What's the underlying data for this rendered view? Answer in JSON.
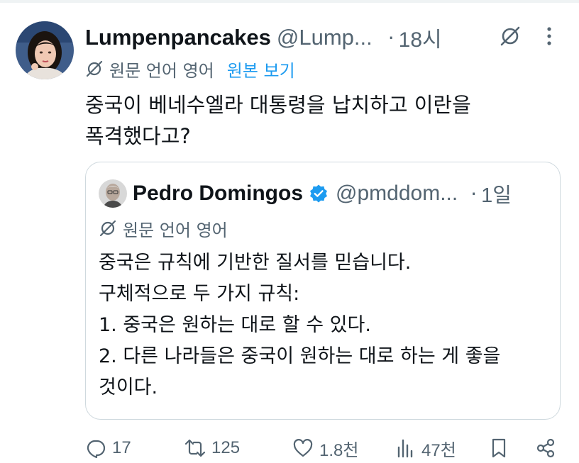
{
  "tweet": {
    "display_name": "Lumpenpancakes",
    "handle": "@Lump...",
    "dot": "·",
    "time": "18시",
    "translated_from": "원문 언어 영어",
    "show_original": "원본 보기",
    "text_lines": [
      "중국이 베네수엘라 대통령을 납치하고 이란을",
      "폭격했다고?"
    ]
  },
  "quote": {
    "display_name": "Pedro Domingos",
    "handle": "@pmddom...",
    "dot": "·",
    "time": "1일",
    "translated_from": "원문 언어 영어",
    "text_lines": [
      "중국은 규칙에 기반한 질서를 믿습니다.",
      "구체적으로 두 가지 규칙:",
      "1. 중국은 원하는 대로 할 수 있다.",
      "2. 다른 나라들은 중국이 원하는 대로 하는 게 좋을",
      "것이다."
    ]
  },
  "actions": {
    "reply_count": "17",
    "repost_count": "125",
    "like_count": "1.8천",
    "view_count": "47천"
  },
  "colors": {
    "text_primary": "#0f1419",
    "text_secondary": "#536471",
    "link": "#1d9bf0",
    "verified_badge": "#1d9bf0",
    "border": "#cfd9de"
  },
  "icons": {
    "translate": "translate-icon",
    "grok": "grok-icon",
    "more": "more-icon",
    "verified": "verified-badge-icon",
    "reply": "reply-icon",
    "repost": "repost-icon",
    "like": "like-icon",
    "views": "views-icon",
    "bookmark": "bookmark-icon",
    "share": "share-icon"
  }
}
